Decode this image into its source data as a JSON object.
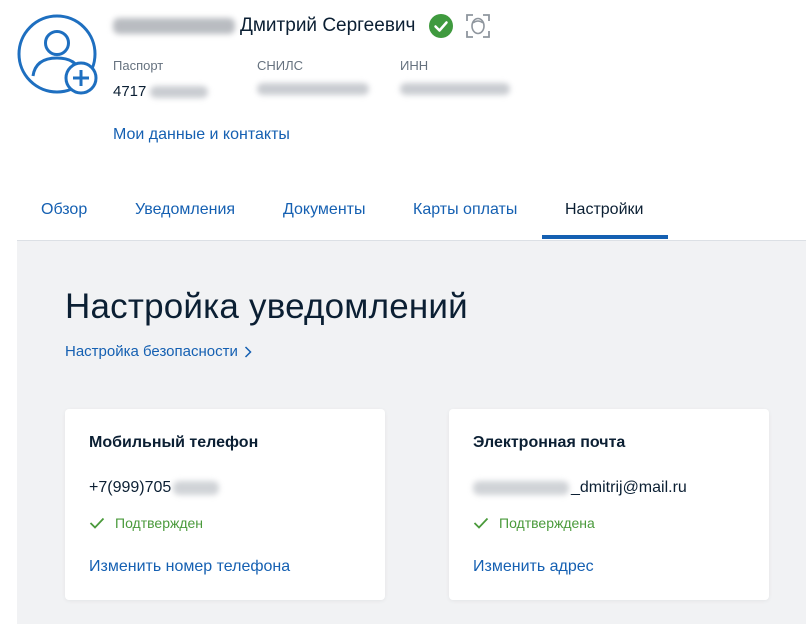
{
  "profile": {
    "name": "Дмитрий Сергеевич",
    "documents": [
      {
        "label": "Паспорт",
        "value": "4717"
      },
      {
        "label": "СНИЛС",
        "value": ""
      },
      {
        "label": "ИНН",
        "value": ""
      }
    ],
    "my_data_link": "Мои данные и контакты"
  },
  "tabs": [
    {
      "label": "Обзор",
      "active": false
    },
    {
      "label": "Уведомления",
      "active": false
    },
    {
      "label": "Документы",
      "active": false
    },
    {
      "label": "Карты оплаты",
      "active": false
    },
    {
      "label": "Настройки",
      "active": true
    }
  ],
  "main": {
    "title": "Настройка уведомлений",
    "security_link": "Настройка безопасности",
    "cards": [
      {
        "title": "Мобильный телефон",
        "value": "+7(999)705",
        "status": "Подтвержден",
        "action": "Изменить номер телефона"
      },
      {
        "title": "Электронная почта",
        "value": "_dmitrij@mail.ru",
        "status": "Подтверждена",
        "action": "Изменить адрес"
      }
    ]
  },
  "colors": {
    "link": "#1560b2",
    "text": "#0b1f33",
    "muted": "#66727f",
    "success": "#4a9a3b",
    "background": "#f1f2f4"
  },
  "icons": [
    "avatar-add-icon",
    "verified-icon",
    "face-id-icon",
    "chevron-right-icon",
    "check-icon"
  ]
}
